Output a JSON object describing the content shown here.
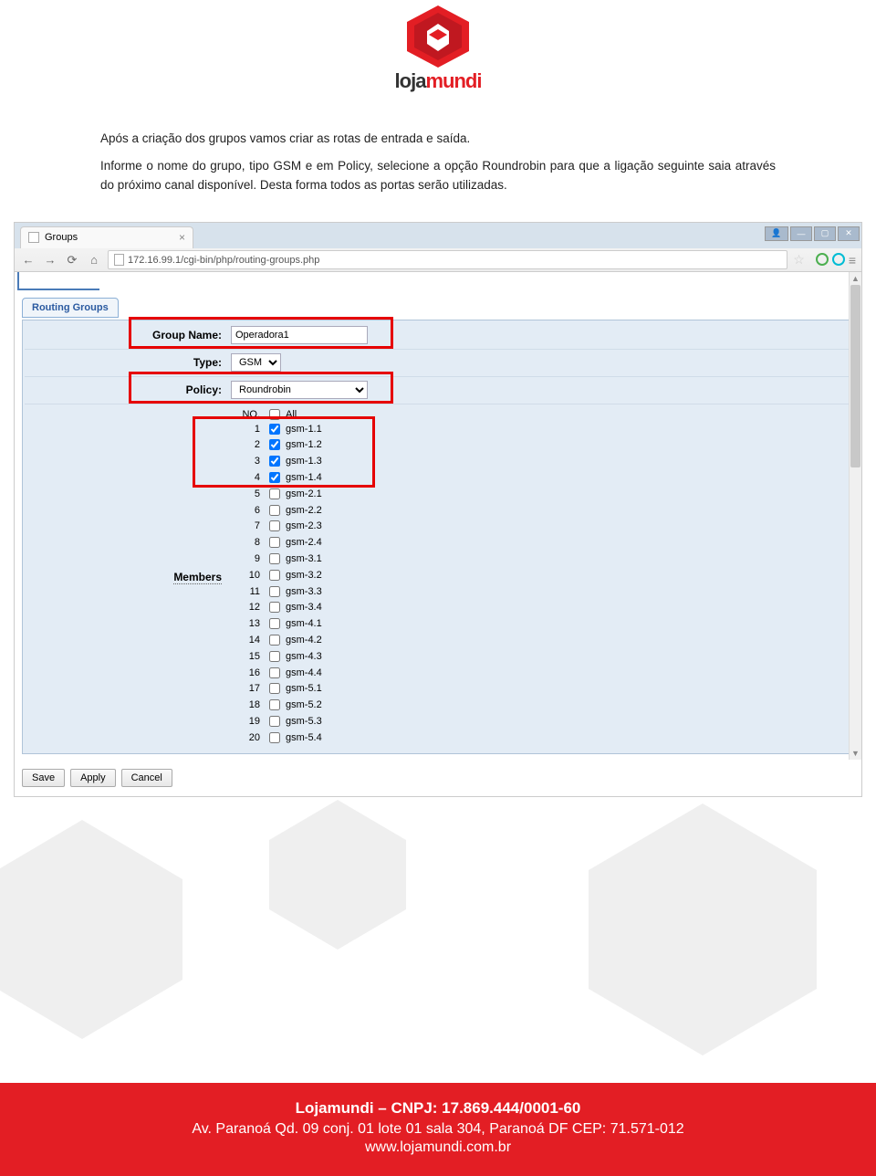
{
  "logo": {
    "brand_a": "loja",
    "brand_b": "mundi"
  },
  "body": {
    "p1": "Após a criação dos grupos vamos criar as rotas de entrada e saída.",
    "p2": "Informe o nome do grupo, tipo GSM e em Policy, selecione a opção Roundrobin para que a ligação seguinte saia através do próximo canal disponível. Desta forma todos as portas serão utilizadas."
  },
  "browser": {
    "tab_title": "Groups",
    "url": "172.16.99.1/cgi-bin/php/routing-groups.php"
  },
  "ui": {
    "tab": "Routing Groups",
    "group_name_label": "Group Name:",
    "group_name_value": "Operadora1",
    "type_label": "Type:",
    "type_value": "GSM",
    "policy_label": "Policy:",
    "policy_value": "Roundrobin",
    "members_label": "Members",
    "no_header": "NO.",
    "all_label": "All",
    "members": [
      {
        "no": "1",
        "name": "gsm-1.1",
        "checked": true
      },
      {
        "no": "2",
        "name": "gsm-1.2",
        "checked": true
      },
      {
        "no": "3",
        "name": "gsm-1.3",
        "checked": true
      },
      {
        "no": "4",
        "name": "gsm-1.4",
        "checked": true
      },
      {
        "no": "5",
        "name": "gsm-2.1",
        "checked": false
      },
      {
        "no": "6",
        "name": "gsm-2.2",
        "checked": false
      },
      {
        "no": "7",
        "name": "gsm-2.3",
        "checked": false
      },
      {
        "no": "8",
        "name": "gsm-2.4",
        "checked": false
      },
      {
        "no": "9",
        "name": "gsm-3.1",
        "checked": false
      },
      {
        "no": "10",
        "name": "gsm-3.2",
        "checked": false
      },
      {
        "no": "11",
        "name": "gsm-3.3",
        "checked": false
      },
      {
        "no": "12",
        "name": "gsm-3.4",
        "checked": false
      },
      {
        "no": "13",
        "name": "gsm-4.1",
        "checked": false
      },
      {
        "no": "14",
        "name": "gsm-4.2",
        "checked": false
      },
      {
        "no": "15",
        "name": "gsm-4.3",
        "checked": false
      },
      {
        "no": "16",
        "name": "gsm-4.4",
        "checked": false
      },
      {
        "no": "17",
        "name": "gsm-5.1",
        "checked": false
      },
      {
        "no": "18",
        "name": "gsm-5.2",
        "checked": false
      },
      {
        "no": "19",
        "name": "gsm-5.3",
        "checked": false
      },
      {
        "no": "20",
        "name": "gsm-5.4",
        "checked": false
      }
    ],
    "buttons": {
      "save": "Save",
      "apply": "Apply",
      "cancel": "Cancel"
    }
  },
  "footer": {
    "line1": "Lojamundi – CNPJ: 17.869.444/0001-60",
    "line2": "Av. Paranoá Qd. 09 conj. 01 lote 01 sala 304, Paranoá DF CEP: 71.571-012",
    "line3": "www.lojamundi.com.br"
  }
}
